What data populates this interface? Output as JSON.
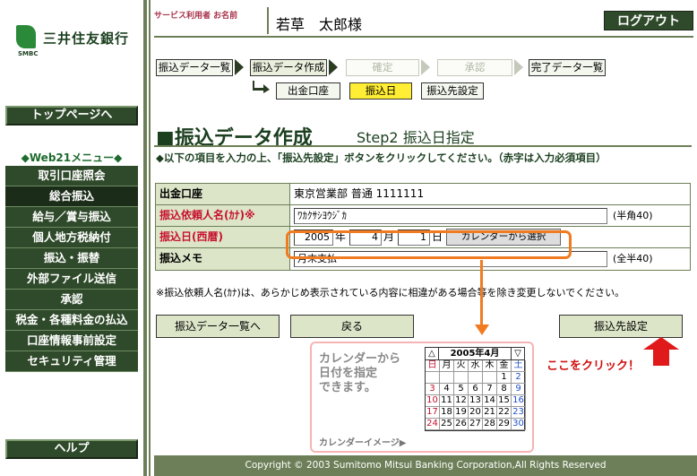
{
  "brand": {
    "name": "三井住友銀行",
    "sub": "SMBC"
  },
  "sidebar": {
    "top_button": "トップページへ",
    "menu_heading": "◆Web21メニュー◆",
    "items": [
      {
        "label": "取引口座照会"
      },
      {
        "label": "総合振込"
      },
      {
        "label": "給与／賞与振込"
      },
      {
        "label": "個人地方税納付"
      },
      {
        "label": "振込・振替"
      },
      {
        "label": "外部ファイル送信"
      },
      {
        "label": "承認"
      },
      {
        "label": "税金・各種料金の払込"
      },
      {
        "label": "口座情報事前設定"
      },
      {
        "label": "セキュリティ管理"
      }
    ],
    "help_button": "ヘルプ"
  },
  "header": {
    "user_label": "サービス利用者 お名前",
    "user_name": "若草　太郎様",
    "logout": "ログアウト"
  },
  "steps": {
    "items": [
      "振込データ一覧",
      "振込データ作成",
      "確定",
      "承認",
      "完了データ一覧"
    ],
    "sub_items": [
      "出金口座",
      "振込日",
      "振込先設定"
    ]
  },
  "title": {
    "main": "■振込データ作成",
    "step": "Step2  振込日指定",
    "instruction": "◆以下の項目を入力の上、「振込先設定」ボタンをクリックしてください。（赤字は入力必須項目）"
  },
  "form": {
    "account_label": "出金口座",
    "account_value": "東京営業部 普通 1111111",
    "requester_label": "振込依頼人名(ｶﾅ)※",
    "requester_value": "ﾜｶｸｻｼﾖｳｼﾞｶ",
    "requester_hint": "(半角40)",
    "date_label": "振込日(西暦)",
    "year_value": "2005",
    "year_unit": "年",
    "month_value": "4",
    "month_unit": "月",
    "day_value": "1",
    "day_unit": "日",
    "calendar_button": "カレンダーから選択",
    "memo_label": "振込メモ",
    "memo_value": "月末支払",
    "memo_hint": "(全半40)",
    "note": "※振込依頼人名(ｶﾅ)は、あらかじめ表示されている内容に相違がある場合等を除き変更しないでください。"
  },
  "buttons": {
    "list": "振込データ一覧へ",
    "back": "戻る",
    "next": "振込先設定"
  },
  "callout": {
    "calendar_desc_1": "カレンダーから",
    "calendar_desc_2": "日付を指定",
    "calendar_desc_3": "できます。",
    "calendar_image_label": "カレンダーイメージ▶",
    "click_here": "ここをクリック！",
    "accent_color": "#f07b21"
  },
  "mini_calendar": {
    "title": "2005年4月",
    "prev": "△",
    "next": "▽",
    "weekdays": [
      "日",
      "月",
      "火",
      "水",
      "木",
      "金",
      "土"
    ],
    "weeks": [
      [
        "",
        "",
        "",
        "",
        "",
        "1",
        "2"
      ],
      [
        "3",
        "4",
        "5",
        "6",
        "7",
        "8",
        "9"
      ],
      [
        "10",
        "11",
        "12",
        "13",
        "14",
        "15",
        "16"
      ],
      [
        "17",
        "18",
        "19",
        "20",
        "21",
        "22",
        "23"
      ],
      [
        "24",
        "25",
        "26",
        "27",
        "28",
        "29",
        "30"
      ]
    ]
  },
  "footer": {
    "copyright": "Copyright © 2003 Sumitomo Mitsui Banking Corporation,All Rights Reserved"
  }
}
